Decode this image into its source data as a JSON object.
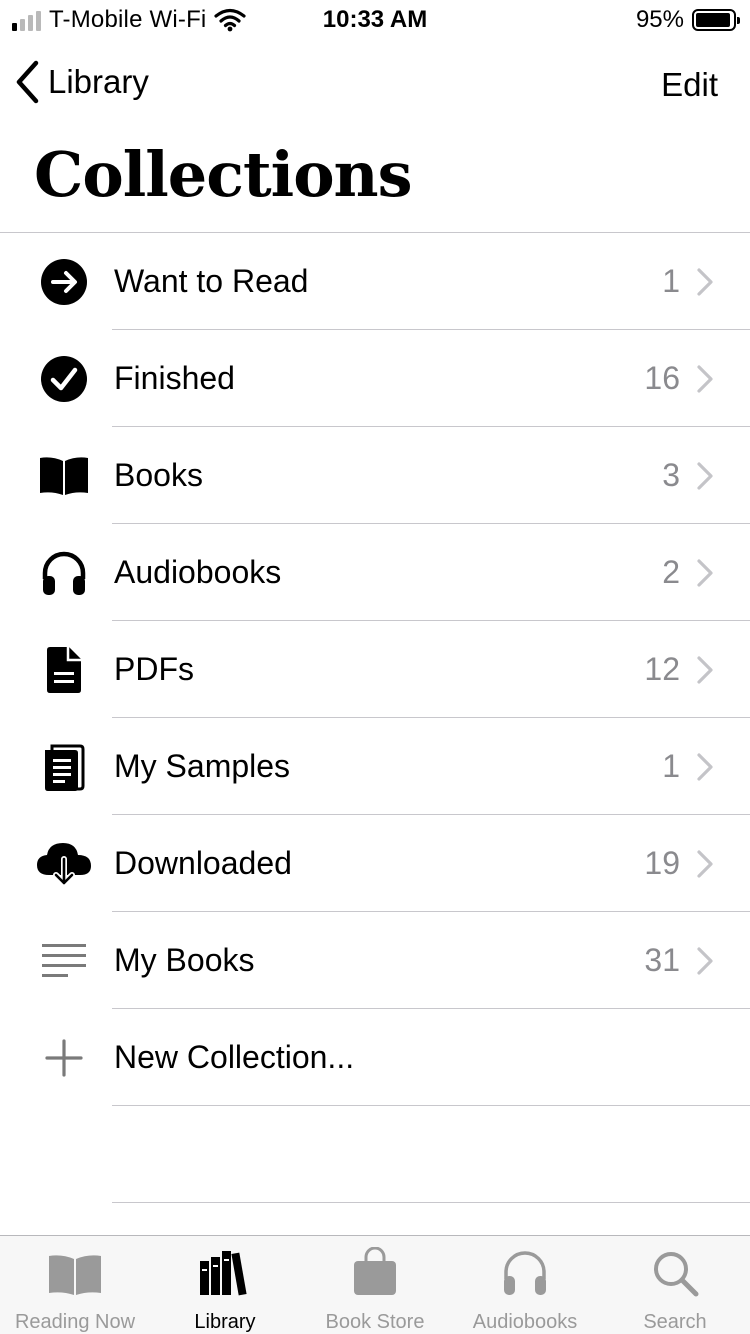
{
  "status_bar": {
    "carrier": "T-Mobile Wi-Fi",
    "time": "10:33 AM",
    "battery": "95%",
    "battery_level": 0.95,
    "signal_bars": 1
  },
  "nav": {
    "back_label": "Library",
    "edit_label": "Edit"
  },
  "page_title": "Collections",
  "collections": [
    {
      "label": "Want to Read",
      "count": "1",
      "icon": "arrow-right-circle-icon"
    },
    {
      "label": "Finished",
      "count": "16",
      "icon": "checkmark-circle-icon"
    },
    {
      "label": "Books",
      "count": "3",
      "icon": "open-book-icon"
    },
    {
      "label": "Audiobooks",
      "count": "2",
      "icon": "headphones-icon"
    },
    {
      "label": "PDFs",
      "count": "12",
      "icon": "document-icon"
    },
    {
      "label": "My Samples",
      "count": "1",
      "icon": "sample-book-icon"
    },
    {
      "label": "Downloaded",
      "count": "19",
      "icon": "cloud-download-icon"
    },
    {
      "label": "My Books",
      "count": "31",
      "icon": "lines-list-icon"
    }
  ],
  "new_collection_label": "New Collection...",
  "tabs": [
    {
      "label": "Reading Now",
      "icon": "open-book-icon"
    },
    {
      "label": "Library",
      "icon": "library-books-icon",
      "active": true
    },
    {
      "label": "Book Store",
      "icon": "shopping-bag-icon"
    },
    {
      "label": "Audiobooks",
      "icon": "headphones-icon"
    },
    {
      "label": "Search",
      "icon": "magnifier-icon"
    }
  ],
  "colors": {
    "secondary_text": "#8a8a8e",
    "separator": "#c8c7cc",
    "tab_inactive": "#9a9a9a",
    "tab_bar_bg": "#f7f7f7"
  }
}
